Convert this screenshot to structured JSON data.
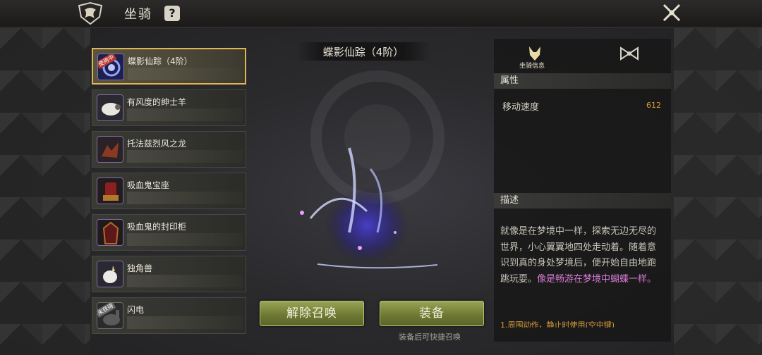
{
  "header": {
    "title": "坐骑",
    "help_label": "?"
  },
  "mounts": [
    {
      "name": "蝶影仙踪（4阶）",
      "tag": "使用中",
      "active": true
    },
    {
      "name": "有风度的绅士羊",
      "tag": "",
      "active": false
    },
    {
      "name": "托法兹烈风之龙",
      "tag": "",
      "active": false
    },
    {
      "name": "吸血鬼宝座",
      "tag": "",
      "active": false
    },
    {
      "name": "吸血鬼的封印柜",
      "tag": "",
      "active": false
    },
    {
      "name": "独角兽",
      "tag": "",
      "active": false
    },
    {
      "name": "闪电",
      "tag": "未获得",
      "active": false
    }
  ],
  "preview": {
    "title": "蝶影仙踪（4阶）",
    "unsummon_label": "解除召唤",
    "equip_label": "装备",
    "hint": "装备后可快捷召唤"
  },
  "info": {
    "tab_label": "坐骑信息",
    "attr_header": "属性",
    "stat_name": "移动速度",
    "stat_value": "612",
    "desc_header": "描述",
    "desc_plain": "就像是在梦境中一样，探索无边无尽的世界，小心翼翼地四处走动着。随着意识到真的身处梦境后，便开始自由地跑跳玩耍。",
    "desc_highlight": "像是畅游在梦境中蝴蝶一样。",
    "desc_extra": "1.周围动作，静止时使用(空中键)"
  },
  "colors": {
    "accent_gold": "#e0b650",
    "button_green": "#7d8a3a",
    "highlight_purple": "#d77ad6",
    "value_orange": "#d49a3a"
  }
}
